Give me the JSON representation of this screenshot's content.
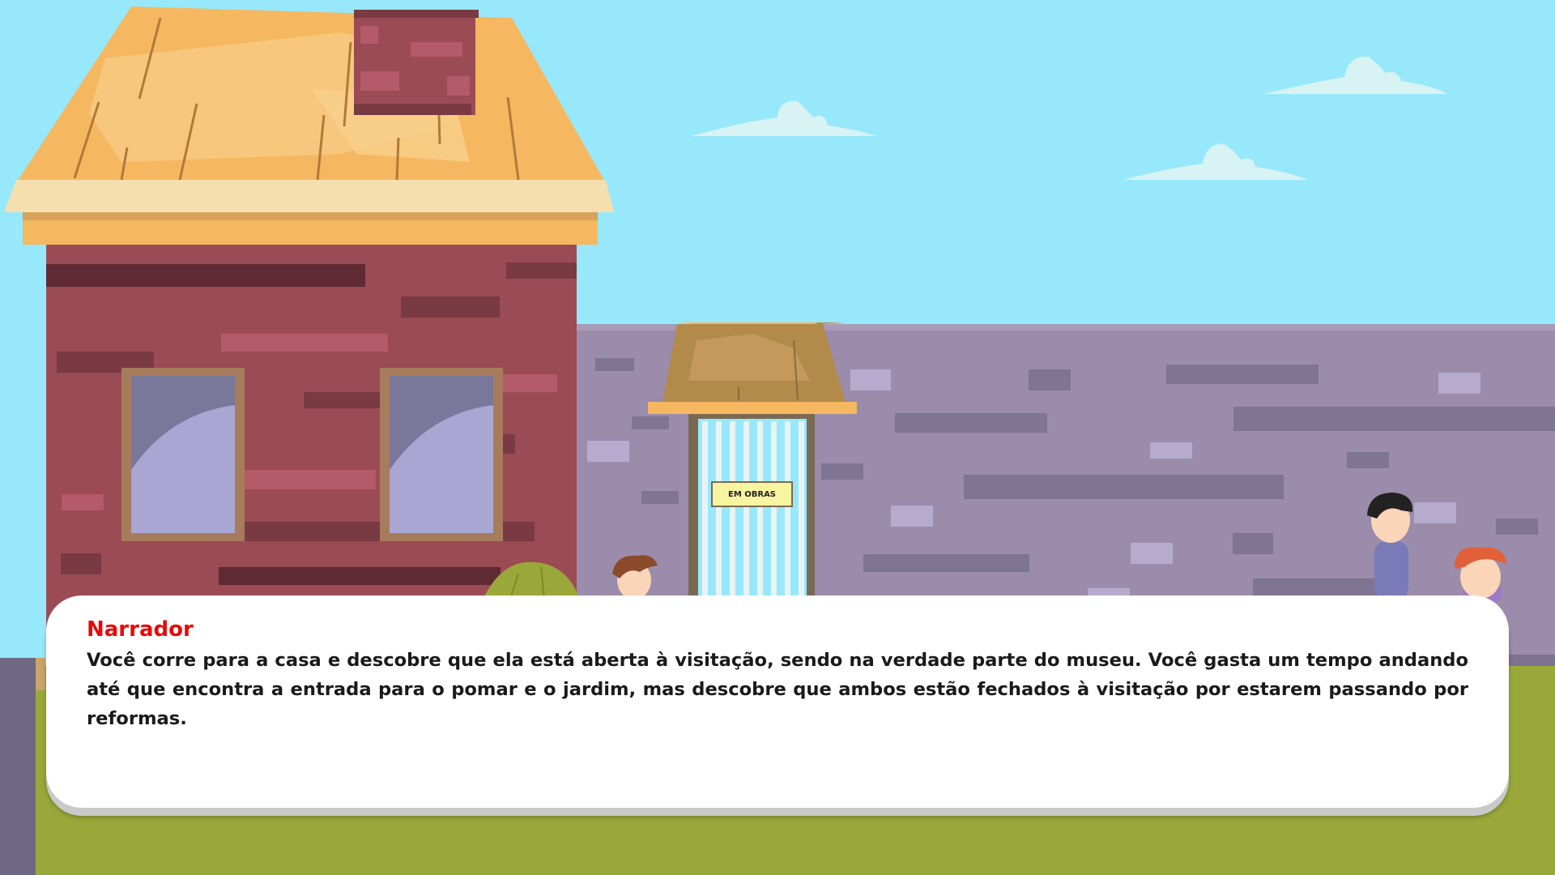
{
  "dialogue": {
    "speaker": "Narrador",
    "text": "Você corre para a casa e descobre que ela está aberta à visitação, sendo na verdade parte do museu. Você gasta um tempo andando até que encontra a entrada para o pomar e o jardim, mas descobre que ambos estão fechados à visitação por estarem passando por reformas."
  },
  "scene": {
    "sign_text": "EM OBRAS",
    "colors": {
      "sky": "#98e8fc",
      "grass": "#9aa83a",
      "brick_house": "#9b4b54",
      "roof": "#f5b860",
      "stone_wall": "#9b8cab",
      "speaker_name": "#e80a0a"
    }
  }
}
